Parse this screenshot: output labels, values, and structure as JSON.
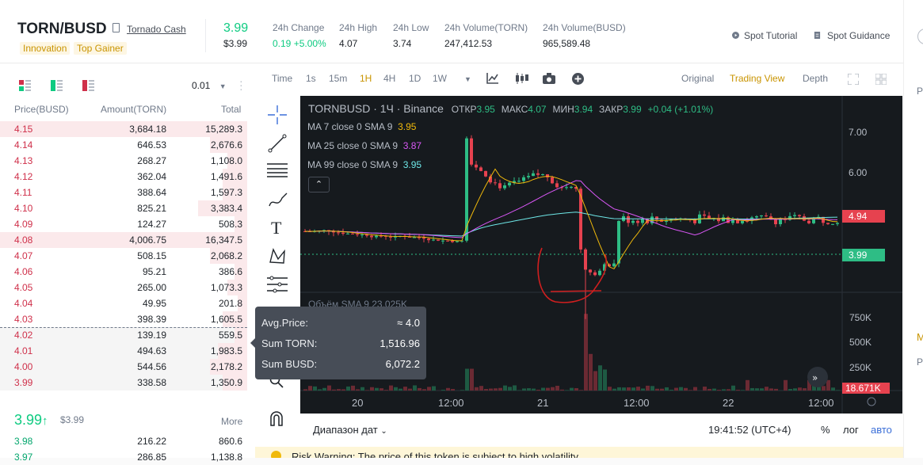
{
  "header": {
    "pair": "TORN/BUSD",
    "project_name": "Tornado Cash",
    "tags": [
      "Innovation",
      "Top Gainer"
    ],
    "last_price": "3.99",
    "last_price_usd": "$3.99",
    "stats": [
      {
        "label": "24h Change",
        "value": "0.19 +5.00%",
        "color": "#0ecb81"
      },
      {
        "label": "24h High",
        "value": "4.07"
      },
      {
        "label": "24h Low",
        "value": "3.74"
      },
      {
        "label": "24h Volume(TORN)",
        "value": "247,412.53"
      },
      {
        "label": "24h Volume(BUSD)",
        "value": "965,589.48"
      }
    ],
    "links": [
      {
        "label": "Spot Tutorial",
        "icon": "play-circle-icon"
      },
      {
        "label": "Spot Guidance",
        "icon": "document-icon"
      }
    ]
  },
  "orderbook": {
    "precision": "0.01",
    "headers": {
      "price": "Price(BUSD)",
      "amount": "Amount(TORN)",
      "total": "Total"
    },
    "asks": [
      {
        "price": "4.15",
        "amount": "3,684.18",
        "total": "15,289.3",
        "depth": 1.0
      },
      {
        "price": "4.14",
        "amount": "646.53",
        "total": "2,676.6",
        "depth": 0.15
      },
      {
        "price": "4.13",
        "amount": "268.27",
        "total": "1,108.0",
        "depth": 0.08
      },
      {
        "price": "4.12",
        "amount": "362.04",
        "total": "1,491.6",
        "depth": 0.1
      },
      {
        "price": "4.11",
        "amount": "388.64",
        "total": "1,597.3",
        "depth": 0.1
      },
      {
        "price": "4.10",
        "amount": "825.21",
        "total": "3,383.4",
        "depth": 0.2
      },
      {
        "price": "4.09",
        "amount": "124.27",
        "total": "508.3",
        "depth": 0.05
      },
      {
        "price": "4.08",
        "amount": "4,006.75",
        "total": "16,347.5",
        "depth": 1.0
      },
      {
        "price": "4.07",
        "amount": "508.15",
        "total": "2,068.2",
        "depth": 0.15
      },
      {
        "price": "4.06",
        "amount": "95.21",
        "total": "386.6",
        "depth": 0.05
      },
      {
        "price": "4.05",
        "amount": "265.00",
        "total": "1,073.3",
        "depth": 0.08
      },
      {
        "price": "4.04",
        "amount": "49.95",
        "total": "201.8",
        "depth": 0.04
      },
      {
        "price": "4.03",
        "amount": "398.39",
        "total": "1,605.5",
        "depth": 0.1
      },
      {
        "price": "4.02",
        "amount": "139.19",
        "total": "559.5",
        "depth": 0.05
      },
      {
        "price": "4.01",
        "amount": "494.63",
        "total": "1,983.5",
        "depth": 0.12
      },
      {
        "price": "4.00",
        "amount": "544.56",
        "total": "2,178.2",
        "depth": 0.15
      },
      {
        "price": "3.99",
        "amount": "338.58",
        "total": "1,350.9",
        "depth": 0.1
      }
    ],
    "mid_price": "3.99",
    "mid_arrow": "↑",
    "mid_usd": "$3.99",
    "more_label": "More",
    "bids": [
      {
        "price": "3.98",
        "amount": "216.22",
        "total": "860.6"
      },
      {
        "price": "3.97",
        "amount": "286.85",
        "total": "1,138.8"
      }
    ]
  },
  "tooltip": {
    "avg_label": "Avg.Price:",
    "avg_value": "≈ 4.0",
    "sum_base_label": "Sum TORN:",
    "sum_base_value": "1,516.96",
    "sum_quote_label": "Sum BUSD:",
    "sum_quote_value": "6,072.2"
  },
  "chart_toolbar": {
    "intervals": [
      "Time",
      "1s",
      "15m",
      "1H",
      "4H",
      "1D",
      "1W"
    ],
    "active_interval": "1H",
    "views": [
      "Original",
      "Trading View",
      "Depth"
    ],
    "active_view": "Trading View",
    "icons": [
      "dropdown-icon",
      "indicator-icon",
      "candles-icon",
      "camera-icon",
      "add-circle-icon"
    ]
  },
  "chart": {
    "symbol_line": "TORNBUSD · 1Ч · Binance",
    "ohlc": [
      {
        "label": "ОТКР",
        "value": "3.95"
      },
      {
        "label": "МАКС",
        "value": "4.07"
      },
      {
        "label": "МИН",
        "value": "3.94"
      },
      {
        "label": "ЗАКР",
        "value": "3.99"
      }
    ],
    "change": "+0.04 (+1.01%)",
    "ma_lines": [
      {
        "label": "MA 7 close 0 SMA 9",
        "value": "3.95",
        "color": "#f0b90b"
      },
      {
        "label": "MA 25 close 0 SMA 9",
        "value": "3.87",
        "color": "#d957f6"
      },
      {
        "label": "MA 99 close 0 SMA 9",
        "value": "3.95",
        "color": "#6ee7e7"
      }
    ],
    "price_axis": [
      "7.00",
      "6.00"
    ],
    "price_labels": [
      {
        "value": "4.94",
        "color": "#e6424f"
      },
      {
        "value": "3.99",
        "color": "#2ebd85"
      }
    ],
    "volume_label": "Объём SMA 9  23.025K",
    "volume_axis": [
      "750K",
      "500K",
      "250K"
    ],
    "volume_current": "18.671K",
    "time_axis": [
      "20",
      "12:00",
      "21",
      "12:00",
      "22",
      "12:00"
    ],
    "footer_left": "Диапазон дат",
    "footer_time": "19:41:52 (UTC+4)",
    "footer_right": [
      "%",
      "лог",
      "авто"
    ],
    "up_color": "#2ebd85",
    "down_color": "#e6424f"
  },
  "warning": {
    "text": "Risk Warning: The price of this token is subject to high volatility"
  }
}
